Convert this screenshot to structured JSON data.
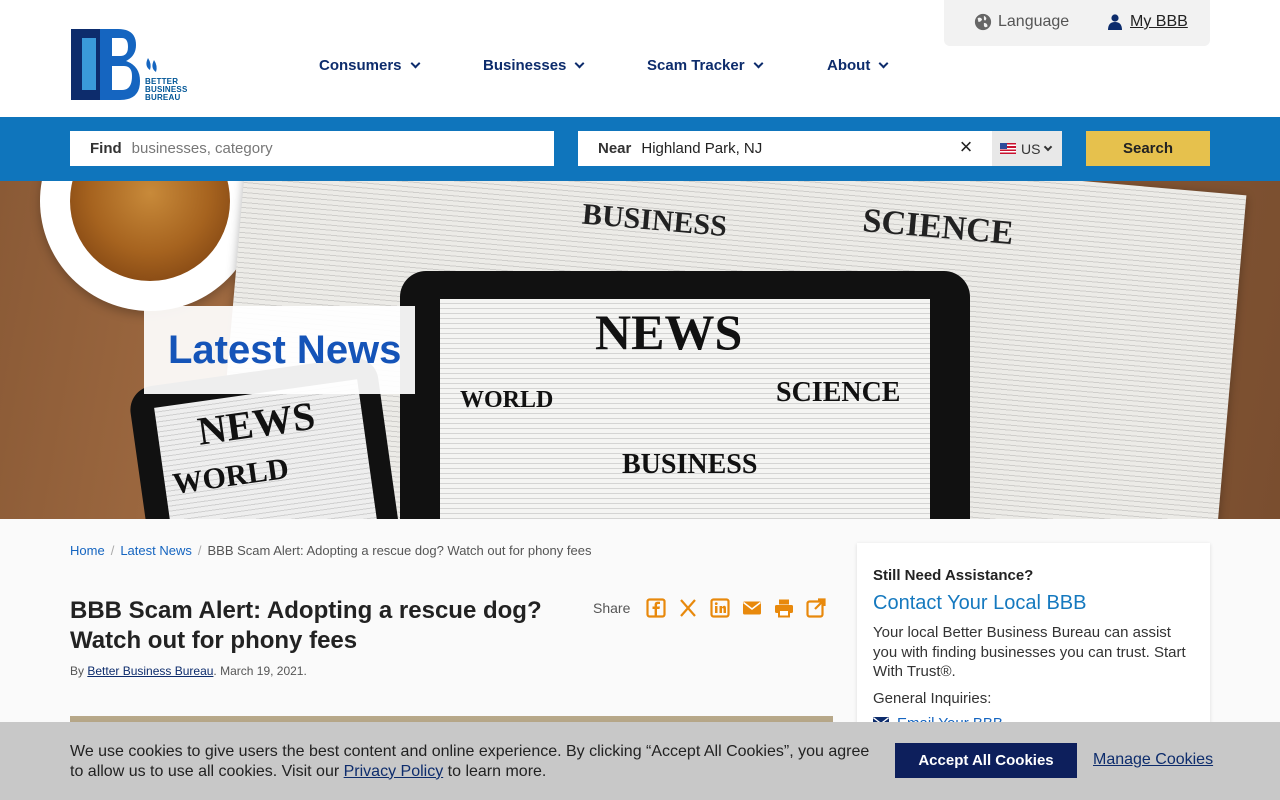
{
  "header": {
    "logo_lines": [
      "BETTER",
      "BUSINESS",
      "BUREAU"
    ],
    "language_label": "Language",
    "my_bbb_label": "My BBB",
    "nav": [
      {
        "label": "Consumers"
      },
      {
        "label": "Businesses"
      },
      {
        "label": "Scam Tracker"
      },
      {
        "label": "About"
      }
    ]
  },
  "search": {
    "find_label": "Find",
    "find_placeholder": "businesses, category",
    "near_label": "Near",
    "near_value": "Highland Park, NJ",
    "country": "US",
    "button_label": "Search"
  },
  "hero": {
    "title": "Latest News",
    "paper_headlines": [
      "BUSINESS",
      "SCIENCE",
      "NEWS",
      "WORLD",
      "SCIENCE",
      "BUSINESS",
      "NEWS",
      "WORLD"
    ]
  },
  "breadcrumb": {
    "home": "Home",
    "section": "Latest News",
    "current": "BBB Scam Alert: Adopting a rescue dog? Watch out for phony fees"
  },
  "article": {
    "title": "BBB Scam Alert: Adopting a rescue dog? Watch out for phony fees",
    "by_prefix": "By ",
    "author": "Better Business Bureau",
    "date": ". March 19, 2021."
  },
  "share": {
    "label": "Share",
    "icons": [
      "facebook-icon",
      "x-icon",
      "linkedin-icon",
      "email-icon",
      "print-icon",
      "external-link-icon"
    ],
    "color": "#e8890c"
  },
  "sidebar": {
    "kicker": "Still Need Assistance?",
    "title": "Contact Your Local BBB",
    "body": "Your local Better Business Bureau can assist you with finding businesses you can trust. Start With Trust®.",
    "general": "General Inquiries:",
    "link": "Email Your BBB"
  },
  "cookie": {
    "text_before": "We use cookies to give users the best content and online experience. By clicking “Accept All Cookies”, you agree to allow us to use all cookies. Visit our ",
    "privacy_link": "Privacy Policy",
    "text_after": " to learn more.",
    "accept_label": "Accept All Cookies",
    "manage_label": "Manage Cookies"
  },
  "colors": {
    "brand_blue": "#0f75bc",
    "navy": "#0d2c6c",
    "search_button": "#e6c14d",
    "hero_title": "#1554b8"
  }
}
